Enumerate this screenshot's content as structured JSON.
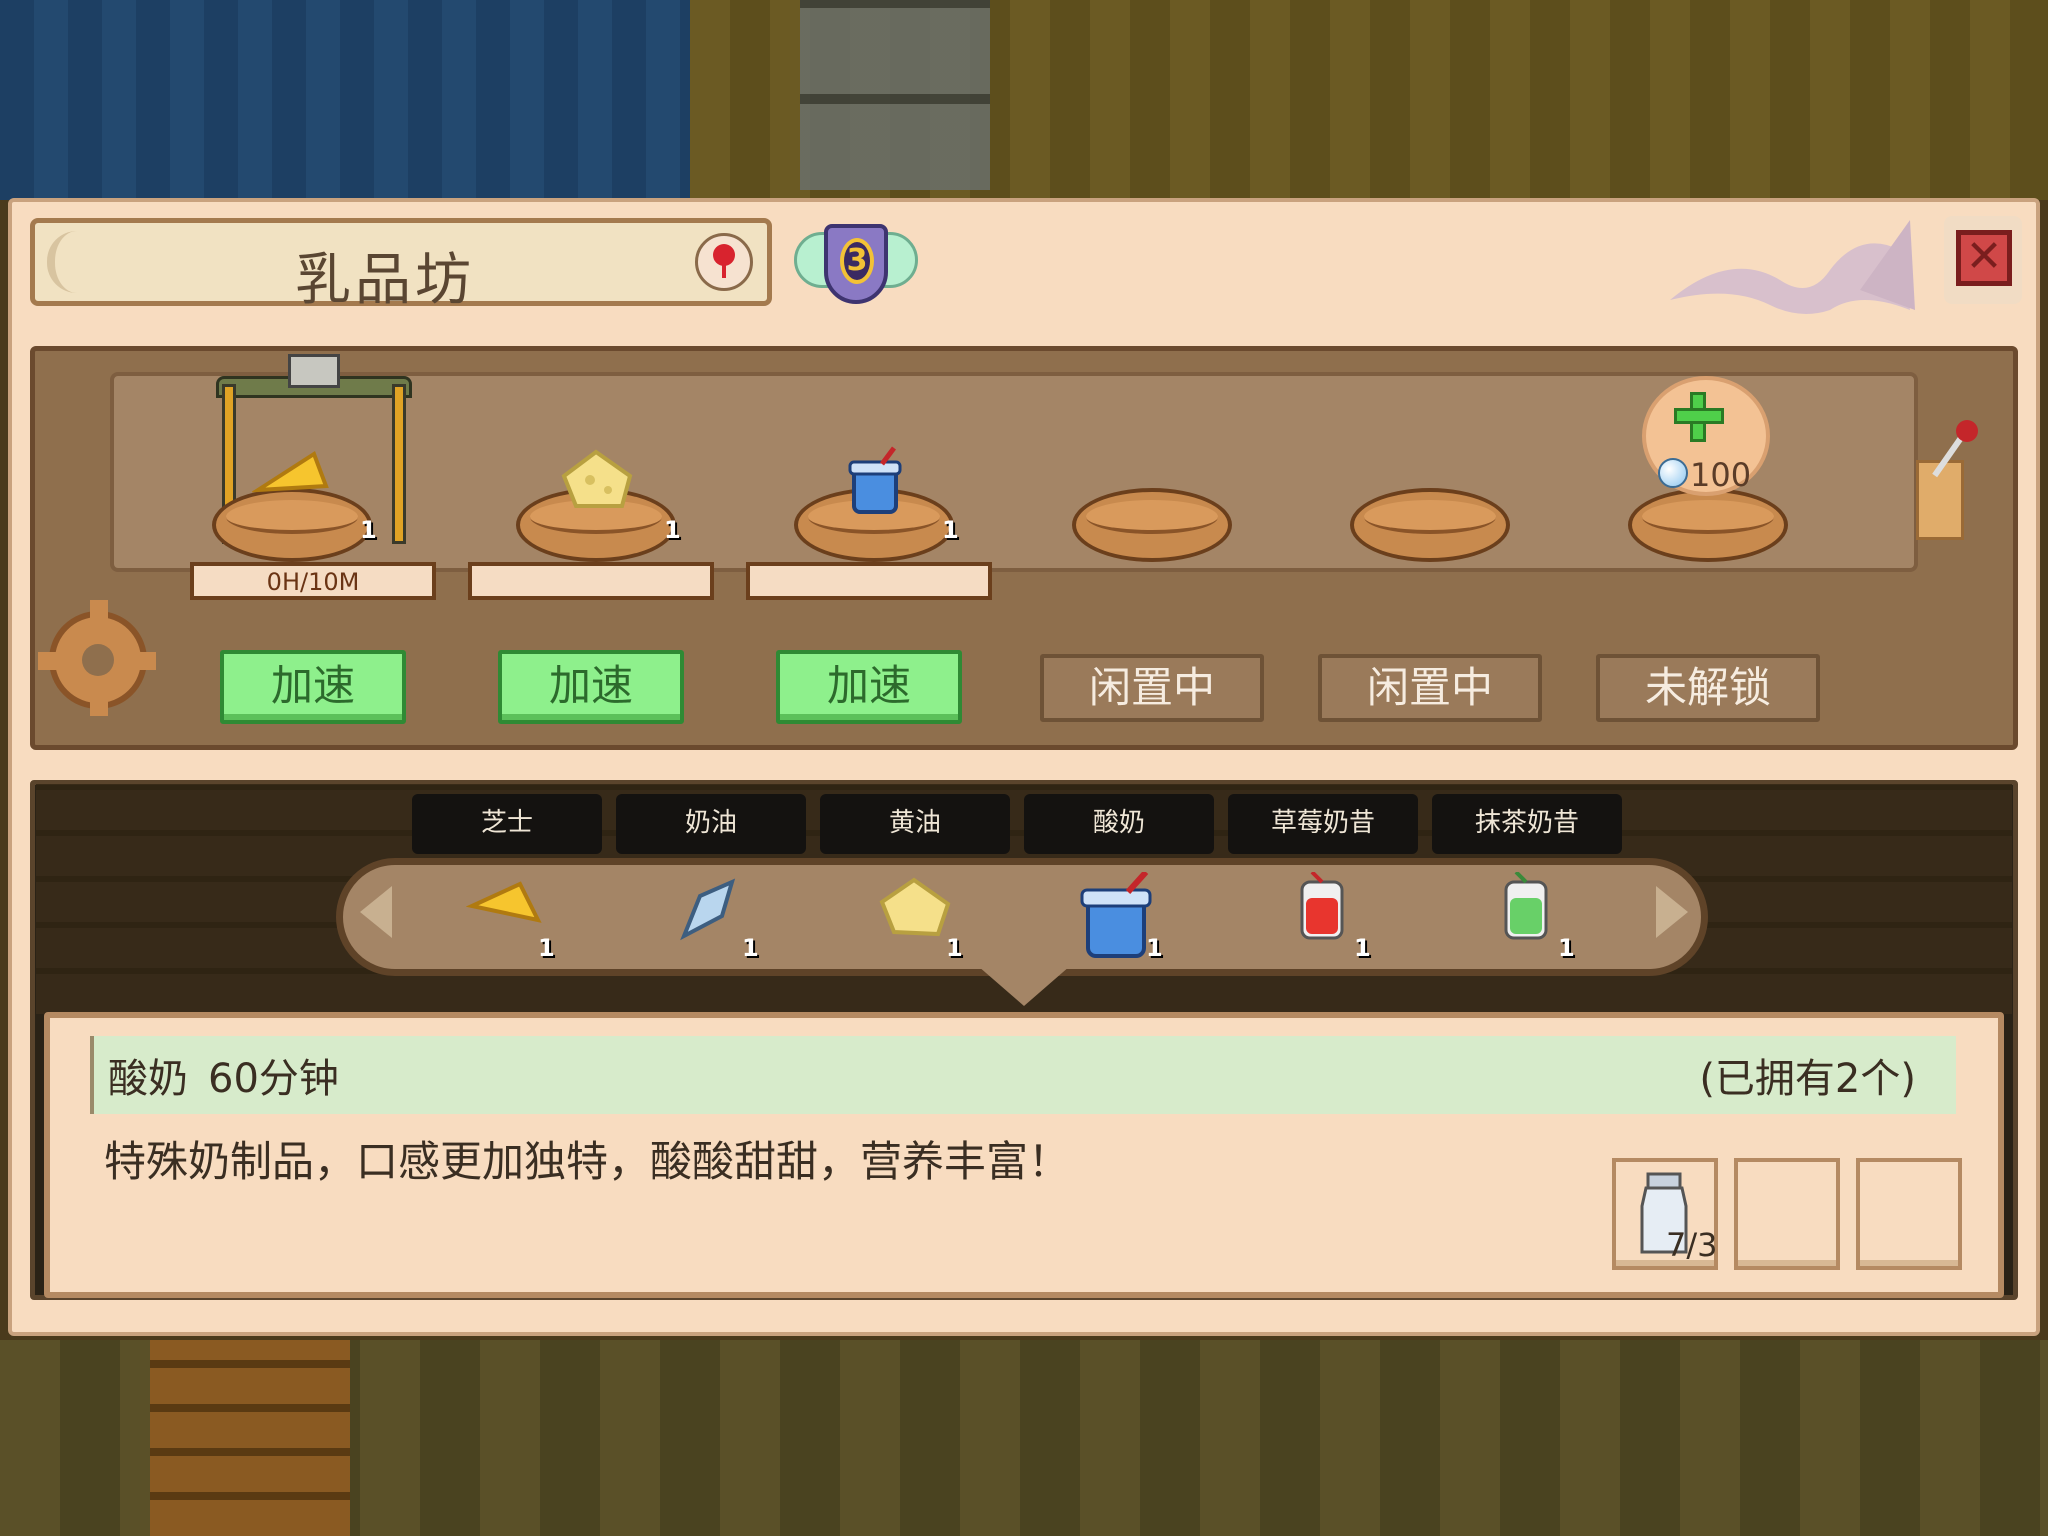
{
  "workshop": {
    "title": "乳品坊",
    "level": "3"
  },
  "slots": [
    {
      "item": "芝士",
      "count": "1",
      "progress_label": "0H/10M",
      "progress": 0.0,
      "button": "加速"
    },
    {
      "item": "黄油",
      "count": "1",
      "progress": 0.0,
      "button": "加速"
    },
    {
      "item": "酸奶",
      "count": "1",
      "progress": 0.0,
      "button": "加速"
    },
    {
      "button": "闲置中"
    },
    {
      "button": "闲置中"
    },
    {
      "unlock_cost": "100",
      "button": "未解锁"
    }
  ],
  "tabs": [
    "芝士",
    "奶油",
    "黄油",
    "酸奶",
    "草莓奶昔",
    "抹茶奶昔"
  ],
  "recipes": [
    {
      "name": "芝士",
      "count": "1",
      "icon": "cheese-icon"
    },
    {
      "name": "奶油",
      "count": "1",
      "icon": "cream-icon"
    },
    {
      "name": "黄油",
      "count": "1",
      "icon": "butter-icon"
    },
    {
      "name": "酸奶",
      "count": "1",
      "icon": "yogurt-icon",
      "selected": true
    },
    {
      "name": "草莓奶昔",
      "count": "1",
      "icon": "strawberry-shake-icon"
    },
    {
      "name": "抹茶奶昔",
      "count": "1",
      "icon": "matcha-shake-icon"
    }
  ],
  "detail": {
    "name": "酸奶",
    "time": "60分钟",
    "owned": "(已拥有2个)",
    "description": "特殊奶制品，口感更加独特，酸酸甜甜，营养丰富！",
    "ingredient_count": "7/3",
    "ingredient_icon": "milk-bottle-icon"
  },
  "colors": {
    "panel": "#f8dcc0",
    "wood": "#8f6f4d",
    "button_green": "#8ef08c",
    "progress_fill": "#a64b1c",
    "detail_header": "#d7ebcb"
  }
}
